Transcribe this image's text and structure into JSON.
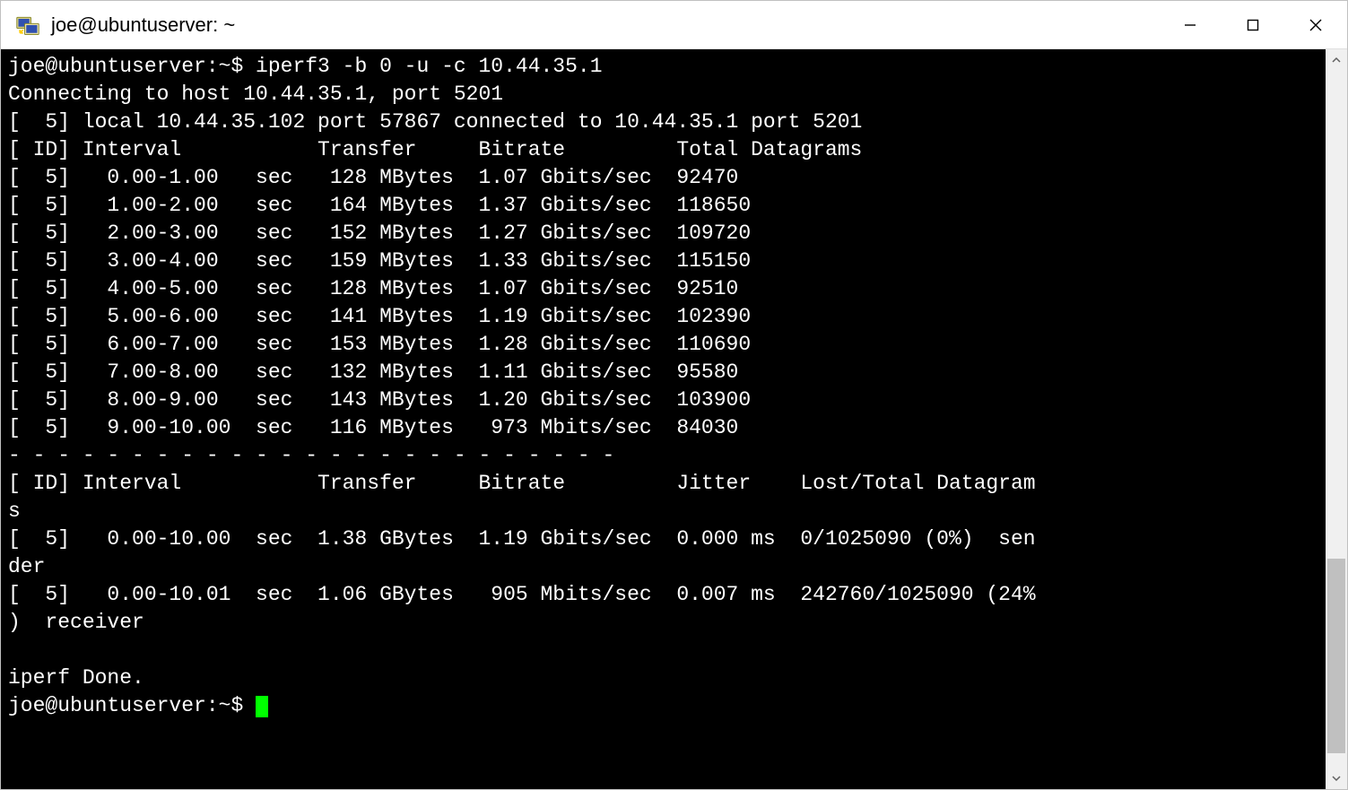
{
  "window": {
    "title": "joe@ubuntuserver: ~"
  },
  "terminal": {
    "prompt": "joe@ubuntuserver:~$",
    "command": "iperf3 -b 0 -u -c 10.44.35.1",
    "connecting_line": "Connecting to host 10.44.35.1, port 5201",
    "local_line": "[  5] local 10.44.35.102 port 57867 connected to 10.44.35.1 port 5201",
    "header1": "[ ID] Interval           Transfer     Bitrate         Total Datagrams",
    "rows": [
      "[  5]   0.00-1.00   sec   128 MBytes  1.07 Gbits/sec  92470",
      "[  5]   1.00-2.00   sec   164 MBytes  1.37 Gbits/sec  118650",
      "[  5]   2.00-3.00   sec   152 MBytes  1.27 Gbits/sec  109720",
      "[  5]   3.00-4.00   sec   159 MBytes  1.33 Gbits/sec  115150",
      "[  5]   4.00-5.00   sec   128 MBytes  1.07 Gbits/sec  92510",
      "[  5]   5.00-6.00   sec   141 MBytes  1.19 Gbits/sec  102390",
      "[  5]   6.00-7.00   sec   153 MBytes  1.28 Gbits/sec  110690",
      "[  5]   7.00-8.00   sec   132 MBytes  1.11 Gbits/sec  95580",
      "[  5]   8.00-9.00   sec   143 MBytes  1.20 Gbits/sec  103900",
      "[  5]   9.00-10.00  sec   116 MBytes   973 Mbits/sec  84030"
    ],
    "separator": "- - - - - - - - - - - - - - - - - - - - - - - - -",
    "header2": "[ ID] Interval           Transfer     Bitrate         Jitter    Lost/Total Datagrams",
    "summary1": "[  5]   0.00-10.00  sec  1.38 GBytes  1.19 Gbits/sec  0.000 ms  0/1025090 (0%)  sender",
    "summary2": "[  5]   0.00-10.01  sec  1.06 GBytes   905 Mbits/sec  0.007 ms  242760/1025090 (24%)  receiver",
    "done_line": "iperf Done.",
    "final_prompt": "joe@ubuntuserver:~$ "
  }
}
